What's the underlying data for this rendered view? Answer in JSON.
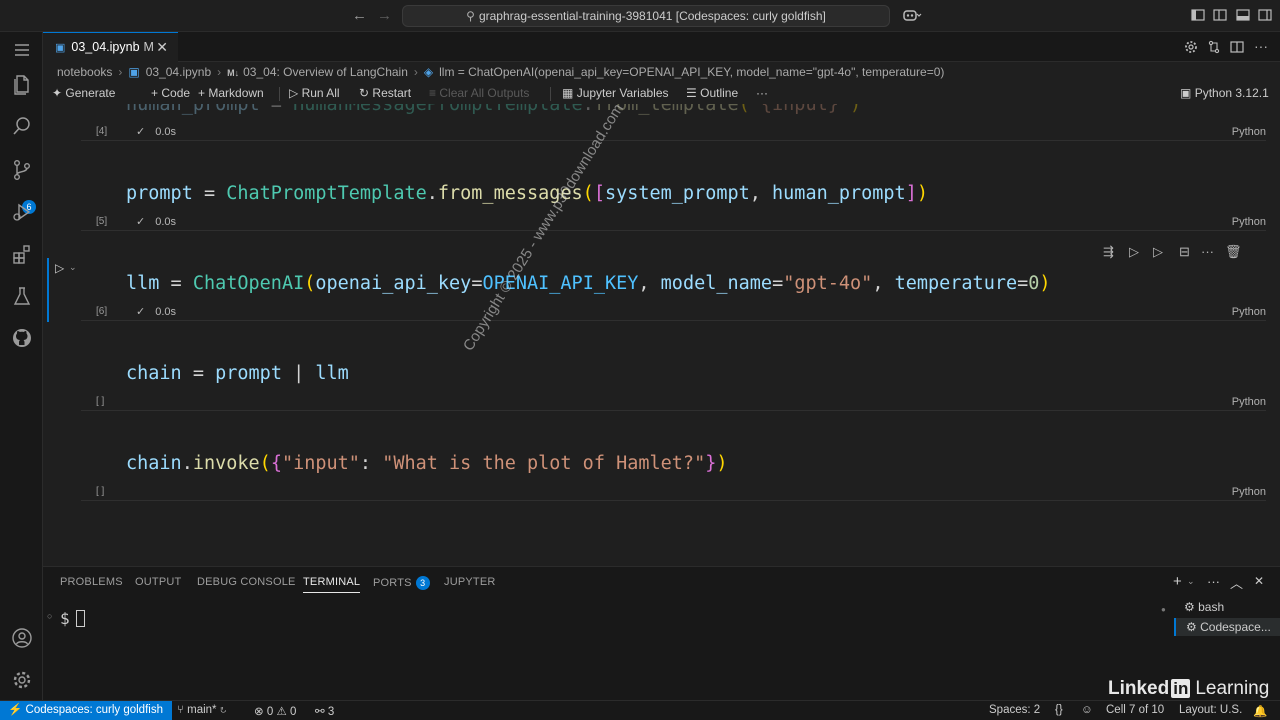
{
  "titlebar": {
    "command_center": "graphrag-essential-training-3981041 [Codespaces: curly goldfish]"
  },
  "activity": {
    "scm_badge": "6"
  },
  "tab": {
    "label": "03_04.ipynb",
    "modified": "M"
  },
  "breadcrumb": {
    "folder": "notebooks",
    "file": "03_04.ipynb",
    "md_prefix": "M↓",
    "section": "03_04: Overview of LangChain",
    "symbol": "llm = ChatOpenAI(openai_api_key=OPENAI_API_KEY, model_name=\"gpt-4o\", temperature=0)"
  },
  "toolbar": {
    "generate": "Generate",
    "code": "Code",
    "markdown": "Markdown",
    "run_all": "Run All",
    "restart": "Restart",
    "clear_outputs": "Clear All Outputs",
    "jupyter_variables": "Jupyter Variables",
    "outline": "Outline",
    "more": "···",
    "kernel": "Python 3.12.1"
  },
  "cells": {
    "c4": {
      "exec": "[4]",
      "time": "0.0s",
      "lang": "Python"
    },
    "c5": {
      "exec": "[5]",
      "time": "0.0s",
      "lang": "Python"
    },
    "c6": {
      "exec": "[6]",
      "time": "0.0s",
      "lang": "Python"
    },
    "c7": {
      "exec": "[ ]",
      "lang": "Python"
    },
    "c8": {
      "exec": "[ ]",
      "lang": "Python"
    }
  },
  "panel": {
    "tabs": [
      "PROBLEMS",
      "OUTPUT",
      "DEBUG CONSOLE",
      "TERMINAL",
      "PORTS",
      "JUPYTER"
    ],
    "ports_badge": "3",
    "prompt": "$",
    "terminals": [
      "bash",
      "Codespace..."
    ]
  },
  "statusbar": {
    "remote": "Codespaces: curly goldfish",
    "branch": "main*",
    "errors": "0",
    "warnings": "0",
    "ports": "3",
    "spaces": "Spaces: 2",
    "braces": "{}",
    "cell": "Cell 7 of 10",
    "layout": "Layout: U.S."
  },
  "watermark": "Copyright © 2025 - www.p30download.com",
  "brand": {
    "linked": "Linked",
    "in": "in",
    "learning": "Learning"
  },
  "colors": {
    "accent": "#0078d4",
    "editor_bg": "#1f1f1f",
    "chrome_bg": "#181818"
  }
}
